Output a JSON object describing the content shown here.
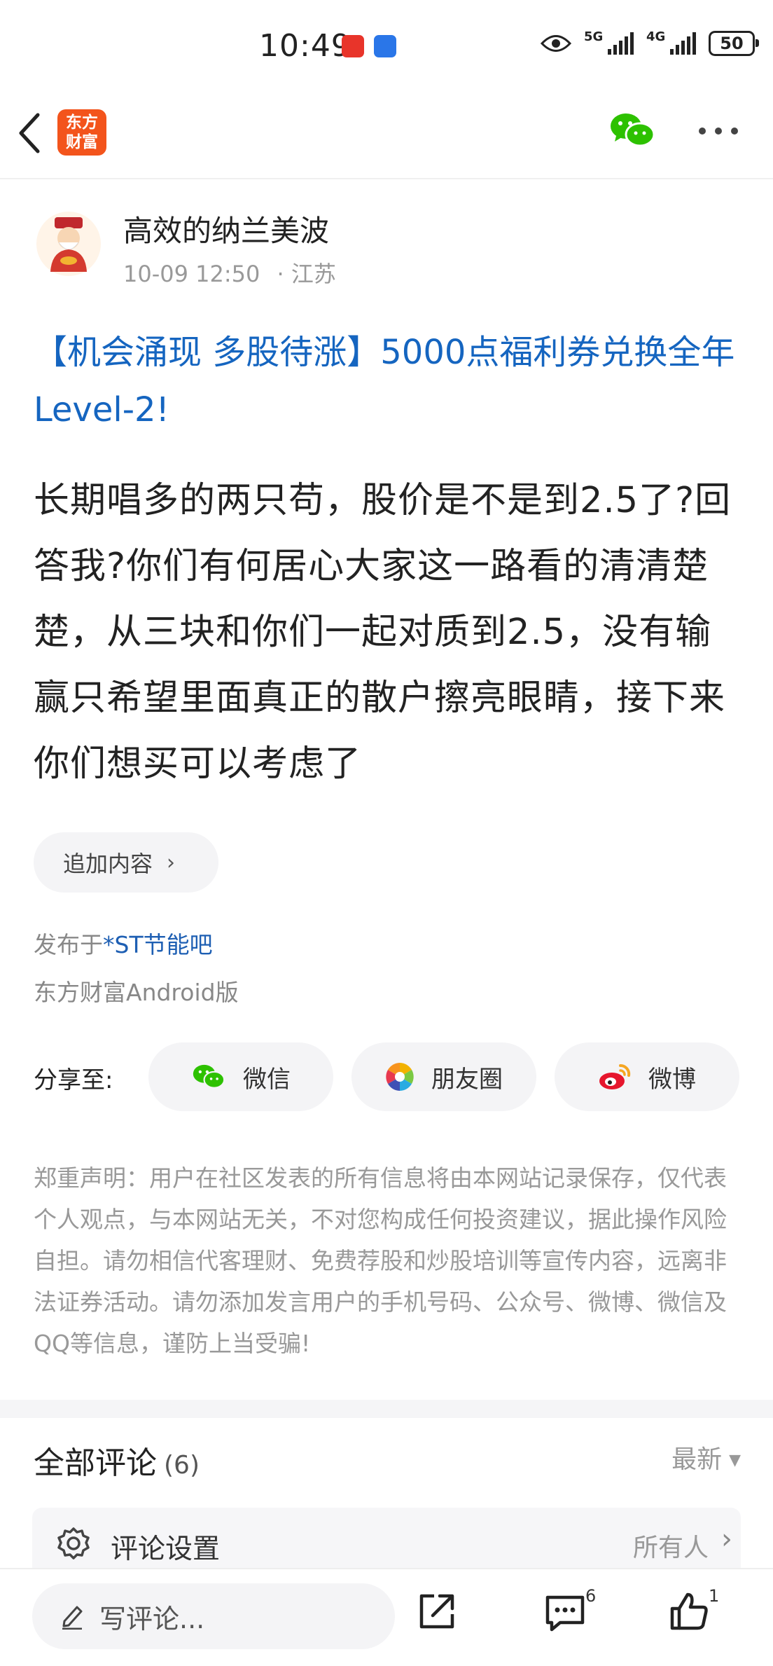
{
  "status_bar": {
    "time": "10:49",
    "network_1": "5G",
    "network_2": "4G",
    "battery": "50"
  },
  "header": {
    "logo_text_1": "东方",
    "logo_text_2": "财富",
    "back_icon": "chevron-left-icon",
    "wechat_icon": "wechat-icon",
    "more_icon": "more-dots-icon"
  },
  "author": {
    "name": "高效的纳兰美波",
    "date": "10-09 12:50",
    "location": "· 江苏"
  },
  "post": {
    "title": "【机会涌现 多股待涨】5000点福利券兑换全年Level-2!",
    "body": "长期唱多的两只苟，股价是不是到2.5了?回答我?你们有何居心大家这一路看的清清楚楚，从三块和你们一起对质到2.5，没有输赢只希望里面真正的散户擦亮眼睛，接下来你们想买可以考虑了",
    "add_content": "追加内容",
    "published_prefix": "发布于",
    "published_forum": "*ST节能吧",
    "client": "东方财富Android版"
  },
  "share": {
    "label": "分享至:",
    "wechat": "微信",
    "moments": "朋友圈",
    "weibo": "微博"
  },
  "disclaimer": "郑重声明：用户在社区发表的所有信息将由本网站记录保存，仅代表个人观点，与本网站无关，不对您构成任何投资建议，据此操作风险自担。请勿相信代客理财、免费荐股和炒股培训等宣传内容，远离非法证券活动。请勿添加发言用户的手机号码、公众号、微博、微信及QQ等信息，谨防上当受骗!",
  "comments": {
    "title": "全部评论",
    "count": "(6)",
    "sort": "最新",
    "settings_label": "评论设置",
    "settings_value": "所有人"
  },
  "bottom_bar": {
    "write_placeholder": "写评论...",
    "comment_count": "6",
    "like_count": "1"
  },
  "colors": {
    "accent_blue": "#1565c0",
    "logo_orange": "#f3541c",
    "wechat_green": "#2dc100"
  }
}
